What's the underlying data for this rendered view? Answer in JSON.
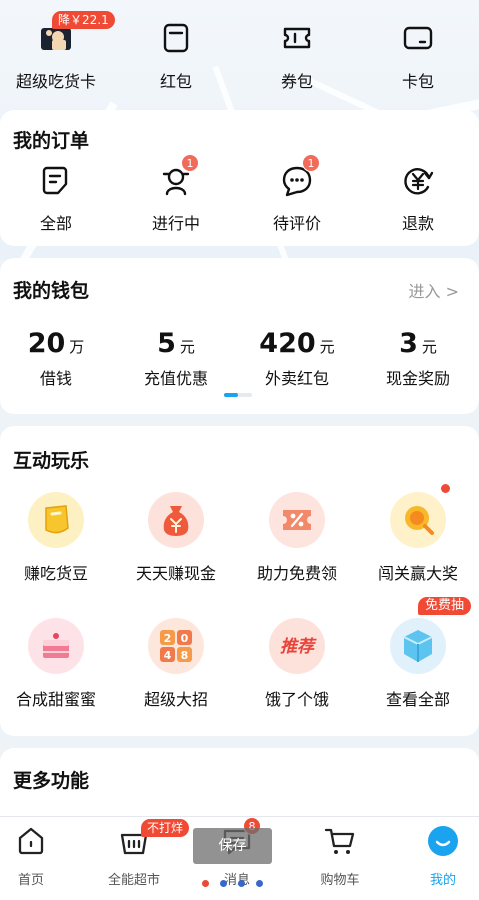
{
  "top": {
    "items": [
      {
        "label": "超级吃货卡",
        "badge": "降￥22.1"
      },
      {
        "label": "红包"
      },
      {
        "label": "券包"
      },
      {
        "label": "卡包"
      }
    ]
  },
  "orders": {
    "title": "我的订单",
    "items": [
      {
        "label": "全部",
        "icon": "document-icon"
      },
      {
        "label": "进行中",
        "icon": "rider-icon",
        "count": "1"
      },
      {
        "label": "待评价",
        "icon": "chat-icon",
        "count": "1"
      },
      {
        "label": "退款",
        "icon": "refund-yen-icon"
      }
    ]
  },
  "wallet": {
    "title": "我的钱包",
    "enter": "进入 >",
    "items": [
      {
        "value": "20",
        "unit": "万",
        "label": "借钱"
      },
      {
        "value": "5",
        "unit": "元",
        "label": "充值优惠"
      },
      {
        "value": "420",
        "unit": "元",
        "label": "外卖红包"
      },
      {
        "value": "3",
        "unit": "元",
        "label": "现金奖励"
      }
    ]
  },
  "play": {
    "title": "互动玩乐",
    "items": [
      {
        "label": "赚吃货豆",
        "icon": "bean-icon"
      },
      {
        "label": "天天赚现金",
        "icon": "money-bag-icon"
      },
      {
        "label": "助力免费领",
        "icon": "coupon-percent-icon"
      },
      {
        "label": "闯关赢大奖",
        "icon": "magnifier-coin-icon"
      },
      {
        "label": "合成甜蜜蜜",
        "icon": "cake-icon"
      },
      {
        "label": "超级大招",
        "icon": "game-2048-icon",
        "tiles": [
          "2",
          "0",
          "4",
          "8"
        ]
      },
      {
        "label": "饿了个饿",
        "icon": "tuijian-icon",
        "stamp": "推荐"
      },
      {
        "label": "查看全部",
        "icon": "cube-icon",
        "badge": "免费抽"
      }
    ]
  },
  "more": {
    "title": "更多功能"
  },
  "nav": {
    "items": [
      {
        "label": "首页",
        "icon": "home-icon"
      },
      {
        "label": "全能超市",
        "icon": "basket-icon",
        "badge": "不打烊"
      },
      {
        "label": "消息",
        "icon": "message-icon",
        "count": "8"
      },
      {
        "label": "购物车",
        "icon": "cart-icon"
      },
      {
        "label": "我的",
        "icon": "profile-icon"
      }
    ]
  },
  "tooltip": {
    "text": "保存"
  },
  "colors": {
    "accent": "#1aa3ef",
    "badge": "#f04a34"
  }
}
